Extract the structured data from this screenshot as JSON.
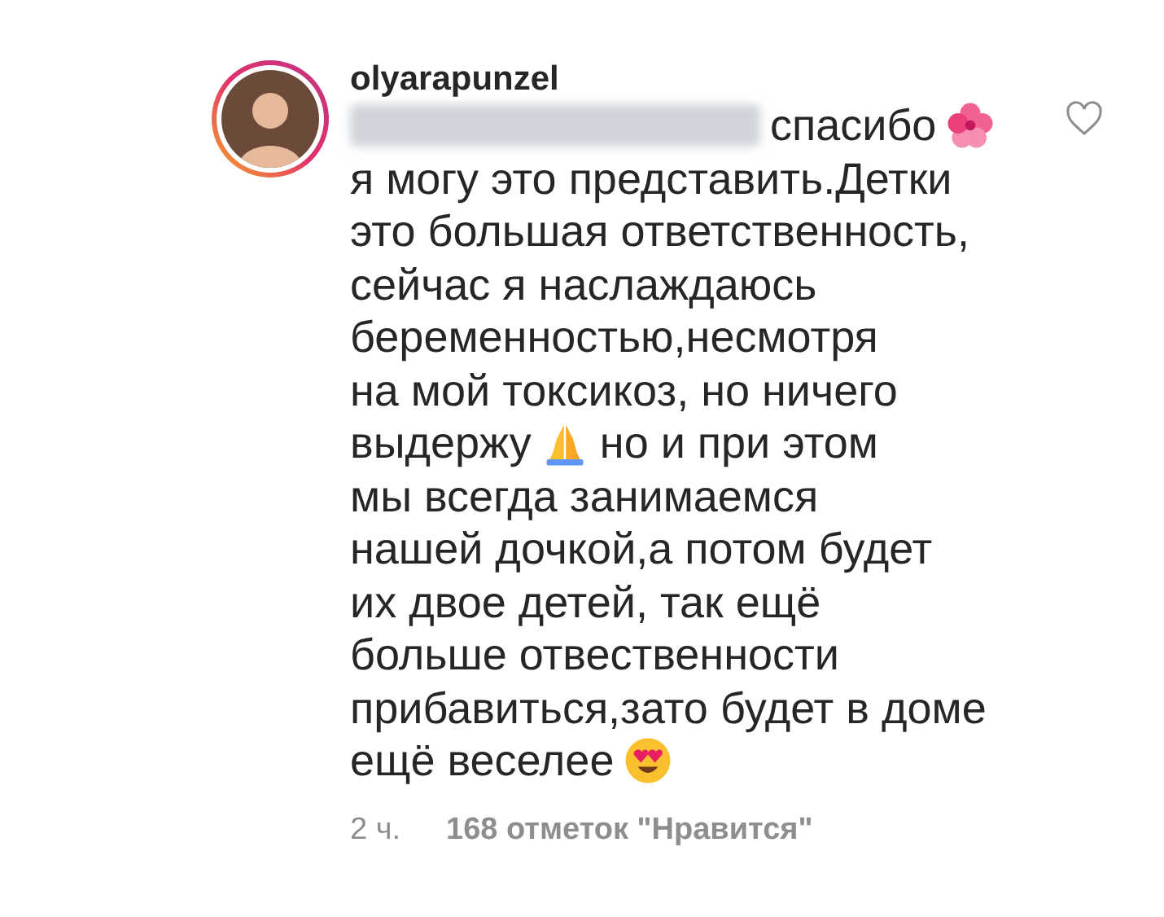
{
  "comment": {
    "username": "olyarapunzel",
    "lines": [
      [
        {
          "kind": "mention"
        },
        {
          "kind": "text",
          "text": "спасибо"
        },
        {
          "kind": "flower"
        }
      ],
      [
        {
          "kind": "text",
          "text": "я могу это представить.Детки"
        }
      ],
      [
        {
          "kind": "text",
          "text": "это большая ответственность,"
        }
      ],
      [
        {
          "kind": "text",
          "text": "сейчас я наслаждаюсь"
        }
      ],
      [
        {
          "kind": "text",
          "text": "беременностью,несмотря"
        }
      ],
      [
        {
          "kind": "text",
          "text": "на мой токсикоз, но ничего"
        }
      ],
      [
        {
          "kind": "text",
          "text": "выдержу"
        },
        {
          "kind": "pray"
        },
        {
          "kind": "text",
          "text": "но и при этом"
        }
      ],
      [
        {
          "kind": "text",
          "text": "мы всегда занимаемся"
        }
      ],
      [
        {
          "kind": "text",
          "text": "нашей дочкой,а потом будет"
        }
      ],
      [
        {
          "kind": "text",
          "text": "их двое детей, так ещё"
        }
      ],
      [
        {
          "kind": "text",
          "text": "больше отвественности"
        }
      ],
      [
        {
          "kind": "text",
          "text": "прибавиться,зато будет в доме"
        }
      ],
      [
        {
          "kind": "text",
          "text": "ещё веселее"
        },
        {
          "kind": "love"
        }
      ]
    ],
    "time": "2 ч.",
    "likes": "168 отметок \"Нравится\"",
    "liked": false
  }
}
